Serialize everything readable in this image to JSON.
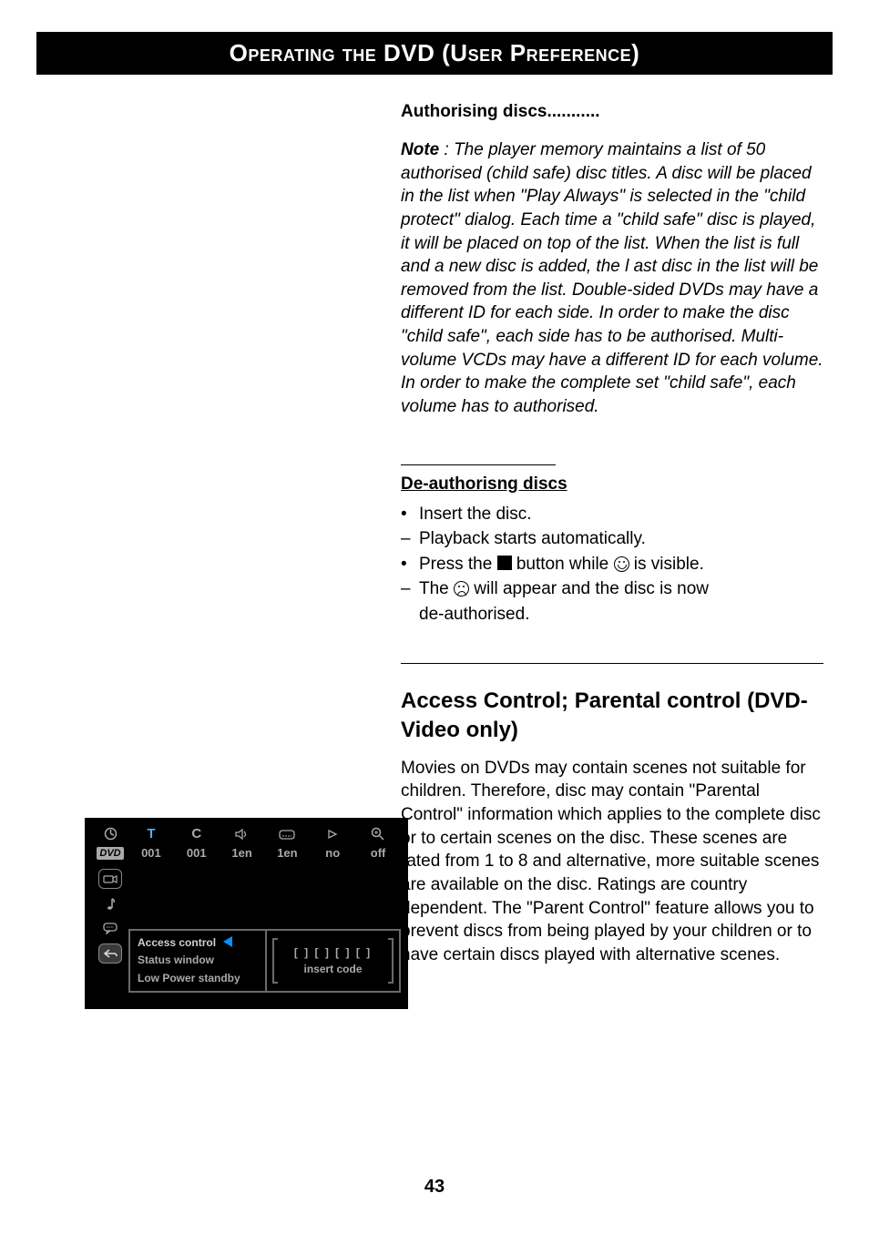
{
  "banner_title": "Operating  the  DVD (User Preference)",
  "section1": {
    "heading": "Authorising discs...........",
    "note_label": "Note",
    "note_body": " : The player memory maintains a list of 50 authorised (child safe) disc titles. A disc will be placed in the list when \"Play Always\" is selected in the \"child protect\" dialog. Each time a \"child safe\" disc is played, it will be placed on top of the list. When the list is full and a new   disc is added, the l ast disc in the list will be removed from the list. Double-sided DVDs may have a different ID for each side. In order to make the disc \"child safe\", each side has to be authorised. Multi-volume VCDs may have a different ID for each volume. In order to make the complete set \"child safe\", each volume has to authorised."
  },
  "section2": {
    "heading": "De-authorisng discs",
    "steps": [
      {
        "bullet": "•",
        "pre": "Insert the disc.",
        "post": ""
      },
      {
        "bullet": "–",
        "pre": "Playback starts automatically.",
        "post": ""
      },
      {
        "bullet": "•",
        "pre": "Press the ",
        "has_stop": true,
        "mid": " button while ",
        "has_smile": true,
        "post": " is visible."
      },
      {
        "bullet": "–",
        "pre": "The ",
        "has_sad": true,
        "mid": " will appear and the disc is now",
        "post2": "de-authorised."
      }
    ]
  },
  "section3": {
    "heading": "Access Control; Parental control (DVD-Video only)",
    "body": "Movies on DVDs may contain scenes not suitable for children. Therefore, disc may contain \"Parental Control\" information which applies to the complete disc or to certain scenes on the disc. These scenes are rated from 1 to 8 and alternative, more suitable scenes are available on the disc. Ratings are country dependent. The \"Parent Control\" feature allows you to prevent discs from being played by your children or to have certain discs played with alternative scenes."
  },
  "osd": {
    "logo": "DVD",
    "header_icons": [
      "clock-icon",
      "T",
      "C",
      "speaker-icon",
      "subtitle-icon",
      "angle-icon",
      "zoom-icon"
    ],
    "row2": [
      "",
      "001",
      "001",
      "1en",
      "1en",
      "no",
      "off"
    ],
    "sidebar": [
      "camera-icon",
      "note-icon",
      "speech-icon",
      "return-icon"
    ],
    "menu_left": {
      "item1": "Access control",
      "item2": "Status window",
      "item3": "Low Power standby"
    },
    "menu_right": {
      "code": "[ ] [ ] [ ] [ ]",
      "label": "insert code"
    }
  },
  "page_number": "43"
}
